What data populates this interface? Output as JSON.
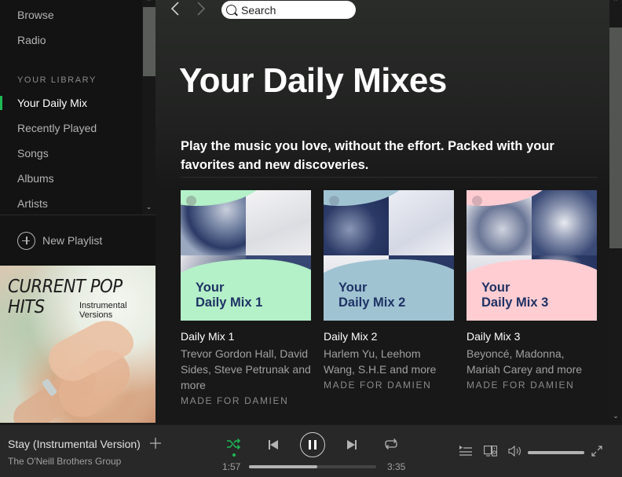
{
  "sidebar": {
    "nav": [
      {
        "label": "Browse"
      },
      {
        "label": "Radio"
      }
    ],
    "library_heading": "YOUR LIBRARY",
    "library": [
      {
        "label": "Your Daily Mix",
        "active": true
      },
      {
        "label": "Recently Played"
      },
      {
        "label": "Songs"
      },
      {
        "label": "Albums"
      },
      {
        "label": "Artists"
      }
    ],
    "new_playlist": "New Playlist",
    "now_playing_art": {
      "title": "CURRENT POP HITS",
      "subtitle": "Instrumental Versions"
    }
  },
  "topbar": {
    "back_icon": "chevron-left-icon",
    "forward_icon": "chevron-right-icon",
    "search_placeholder": "Search"
  },
  "main": {
    "title": "Your Daily Mixes",
    "tagline": "Play the music you love, without the effort. Packed with your favorites and new discoveries.",
    "mixes": [
      {
        "cover_text_1": "Your",
        "cover_text_2": "Daily Mix 1",
        "title": "Daily Mix 1",
        "artists": "Trevor Gordon Hall, David Sides, Steve Petrunak and more",
        "made_for": "MADE FOR DAMIEN",
        "color": "#b4f0c8",
        "text_color": "#1e3264"
      },
      {
        "cover_text_1": "Your",
        "cover_text_2": "Daily Mix 2",
        "title": "Daily Mix 2",
        "artists": "Harlem Yu, Leehom Wang, S.H.E and more",
        "made_for": "MADE FOR DAMIEN",
        "color": "#a0c3d2",
        "text_color": "#1e3264"
      },
      {
        "cover_text_1": "Your",
        "cover_text_2": "Daily Mix 3",
        "title": "Daily Mix 3",
        "artists": "Beyoncé, Madonna, Mariah Carey and more",
        "made_for": "MADE FOR DAMIEN",
        "color": "#ffcdd2",
        "text_color": "#1e3264"
      }
    ]
  },
  "player": {
    "track": "Stay (Instrumental Version)",
    "artist": "The O'Neill Brothers Group",
    "elapsed": "1:57",
    "total": "3:35",
    "progress_percent": 54,
    "volume_percent": 100,
    "shuffle_active": true,
    "state": "playing",
    "accent": "#1db954"
  }
}
